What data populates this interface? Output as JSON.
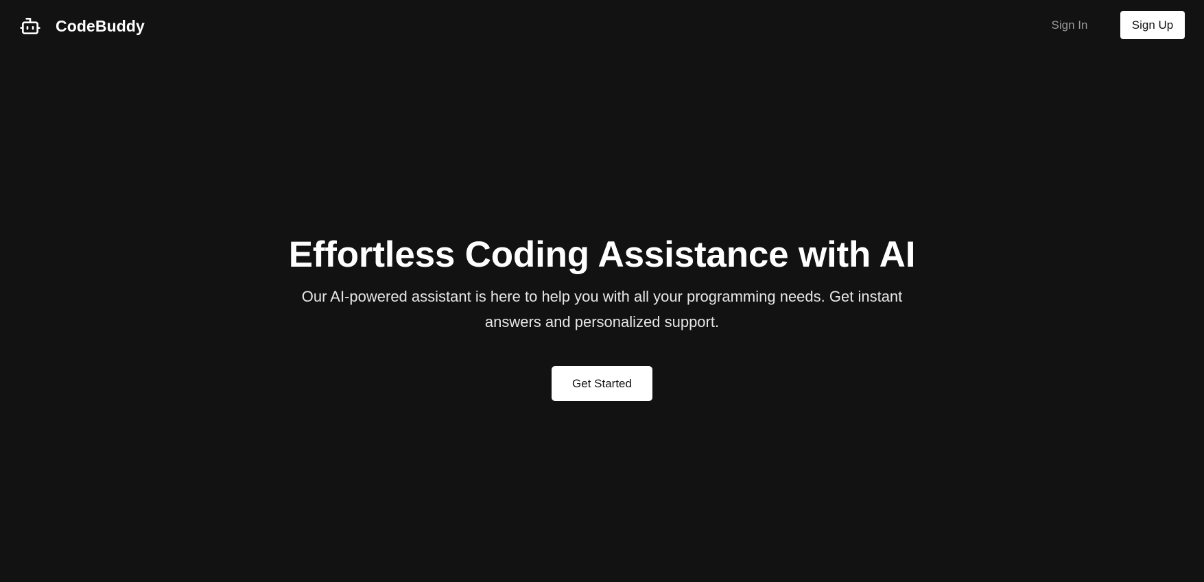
{
  "header": {
    "brand_name": "CodeBuddy",
    "brand_icon": "robot-icon",
    "sign_in_label": "Sign In",
    "sign_up_label": "Sign Up"
  },
  "hero": {
    "title": "Effortless Coding Assistance with AI",
    "subtitle": "Our AI-powered assistant is here to help you with all your programming needs. Get instant answers and personalized support.",
    "cta_label": "Get Started"
  },
  "colors": {
    "background": "#121212",
    "text": "#ffffff",
    "muted_text": "#9a9a9a",
    "button_bg": "#ffffff",
    "button_text": "#121212"
  }
}
